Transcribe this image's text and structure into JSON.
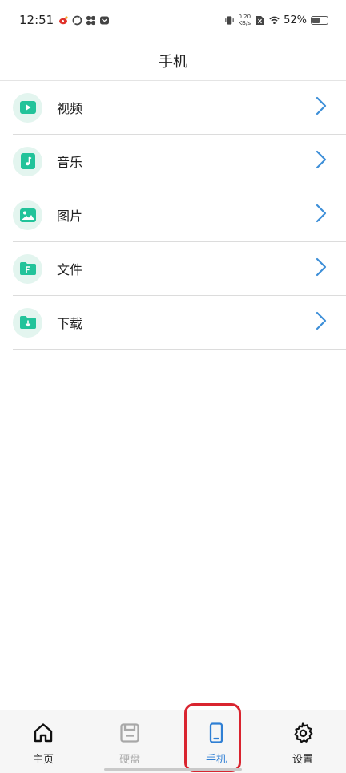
{
  "status_bar": {
    "time": "12:51",
    "net_speed_value": "0.20",
    "net_speed_unit": "KB/s",
    "battery_percent": "52%",
    "battery_level": 0.52
  },
  "header": {
    "title": "手机"
  },
  "list": {
    "items": [
      {
        "label": "视频",
        "icon": "video-icon"
      },
      {
        "label": "音乐",
        "icon": "music-icon"
      },
      {
        "label": "图片",
        "icon": "image-icon"
      },
      {
        "label": "文件",
        "icon": "file-icon"
      },
      {
        "label": "下载",
        "icon": "download-icon"
      }
    ]
  },
  "bottom_nav": {
    "items": [
      {
        "label": "主页",
        "icon": "home-icon",
        "state": "normal"
      },
      {
        "label": "硬盘",
        "icon": "disk-icon",
        "state": "disabled"
      },
      {
        "label": "手机",
        "icon": "phone-icon",
        "state": "active"
      },
      {
        "label": "设置",
        "icon": "settings-icon",
        "state": "normal"
      }
    ]
  },
  "colors": {
    "accent_green": "#22c39a",
    "icon_bg": "#e3f5ef",
    "chevron_blue": "#3d8fd8",
    "active_blue": "#2f7fd4",
    "highlight_red": "#d9242f"
  }
}
